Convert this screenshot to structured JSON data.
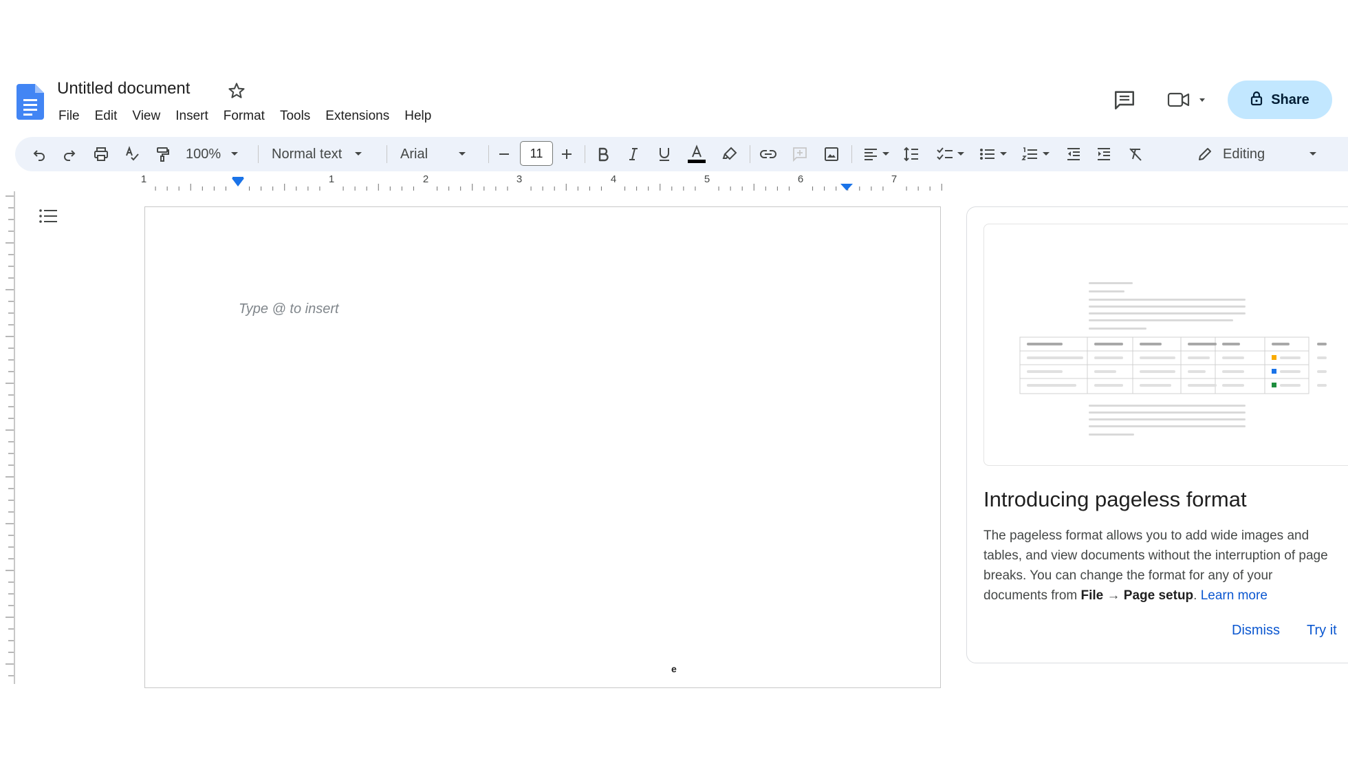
{
  "header": {
    "title": "Untitled document",
    "menu": [
      "File",
      "Edit",
      "View",
      "Insert",
      "Format",
      "Tools",
      "Extensions",
      "Help"
    ],
    "share_label": "Share"
  },
  "toolbar": {
    "zoom": "100%",
    "style": "Normal text",
    "font": "Arial",
    "font_size": "11",
    "mode": "Editing"
  },
  "ruler": {
    "labels": [
      "1",
      "1",
      "2",
      "3",
      "4",
      "5",
      "6",
      "7"
    ]
  },
  "document": {
    "placeholder": "Type @ to insert",
    "stray_char": "e"
  },
  "promo": {
    "title": "Introducing pageless format",
    "body_line1": "The pageless format allows you to add wide images and",
    "body_line2": "tables, and view documents without the interruption of page",
    "body_line3": "breaks. You can change the format for any of your",
    "body_line4_prefix": "documents from ",
    "body_line4_file": "File",
    "body_line4_arrow": " → ",
    "body_line4_setup": "Page setup",
    "body_line4_period": ". ",
    "learn_more": "Learn more",
    "dismiss": "Dismiss",
    "try_it": "Try it"
  },
  "colors": {
    "accent_blue": "#0b57d0",
    "share_bg": "#c2e7ff",
    "toolbar_bg": "#edf2fa",
    "docs_blue": "#4285f4"
  }
}
